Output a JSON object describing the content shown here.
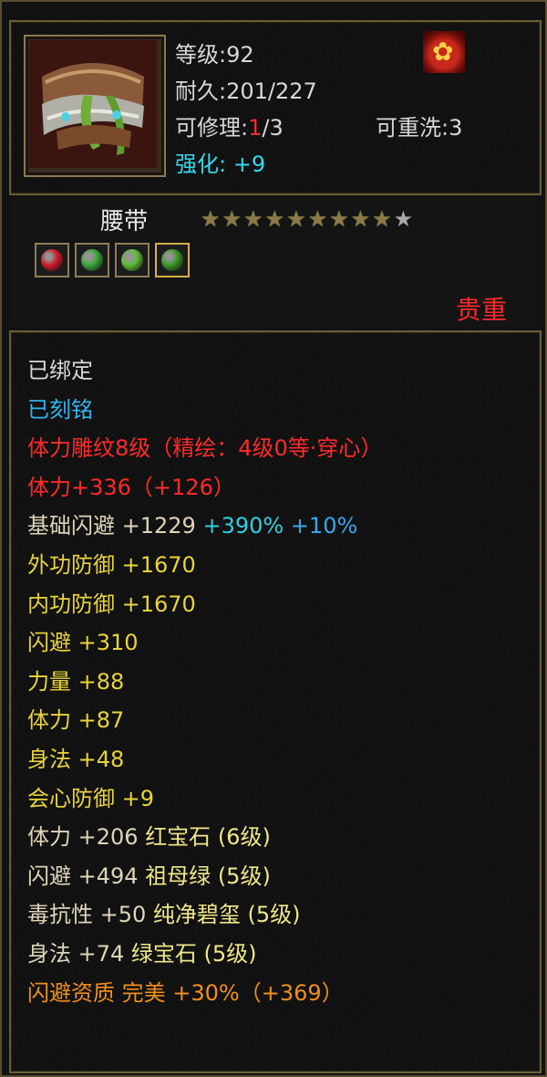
{
  "header": {
    "level_label": "等级",
    "level_value": "92",
    "durability_label": "耐久",
    "durability_value": "201/227",
    "repair_label": "可修理",
    "repair_current": "1",
    "repair_max": "/3",
    "rewash_label": "可重洗",
    "rewash_value": "3",
    "enhance_label": "强化:",
    "enhance_value": "+9",
    "brand_icon": "flame-emblem-icon",
    "item_icon": "belt-icon"
  },
  "item": {
    "type": "腰带",
    "stars_total": 10,
    "stars_filled": 9,
    "quality": "贵重",
    "gems": [
      {
        "name": "ruby-gem-icon",
        "color": "#d0202a"
      },
      {
        "name": "emerald-gem-icon",
        "color": "#3ea83a"
      },
      {
        "name": "green-gem-icon",
        "color": "#5fbf3a"
      },
      {
        "name": "jade-gem-icon",
        "color": "#3e9a2a"
      }
    ]
  },
  "properties": [
    {
      "text": "已绑定",
      "color": "white"
    },
    {
      "text": "已刻铭",
      "color": "cyan"
    },
    {
      "text": "体力雕纹8级（精绘：4级0等·穿心）",
      "color": "red"
    },
    {
      "text": "体力+336（+126）",
      "color": "red"
    },
    {
      "parts": [
        {
          "text": "基础闪避 +1229 ",
          "color": "tan"
        },
        {
          "text": "+390% ",
          "color": "teal"
        },
        {
          "text": "+10%",
          "color": "blue"
        }
      ]
    },
    {
      "text": "外功防御 +1670",
      "color": "yellow"
    },
    {
      "text": "内功防御 +1670",
      "color": "yellow"
    },
    {
      "text": "闪避 +310",
      "color": "yellow"
    },
    {
      "text": "力量 +88",
      "color": "yellow"
    },
    {
      "text": "体力 +87",
      "color": "yellow"
    },
    {
      "text": "身法 +48",
      "color": "yellow"
    },
    {
      "text": "会心防御 +9",
      "color": "yellow"
    },
    {
      "parts": [
        {
          "text": "体力 +206 ",
          "color": "tan"
        },
        {
          "text": "红宝石 (6级)",
          "color": "gold"
        }
      ]
    },
    {
      "parts": [
        {
          "text": "闪避 +494 ",
          "color": "tan"
        },
        {
          "text": "祖母绿 (5级)",
          "color": "gold"
        }
      ]
    },
    {
      "parts": [
        {
          "text": "毒抗性 +50 ",
          "color": "tan"
        },
        {
          "text": "纯净碧玺 (5级)",
          "color": "gold"
        }
      ]
    },
    {
      "parts": [
        {
          "text": "身法 +74 ",
          "color": "tan"
        },
        {
          "text": "绿宝石 (5级)",
          "color": "gold"
        }
      ]
    },
    {
      "text": "闪避资质  完美 +30%（+369）",
      "color": "orange"
    }
  ]
}
